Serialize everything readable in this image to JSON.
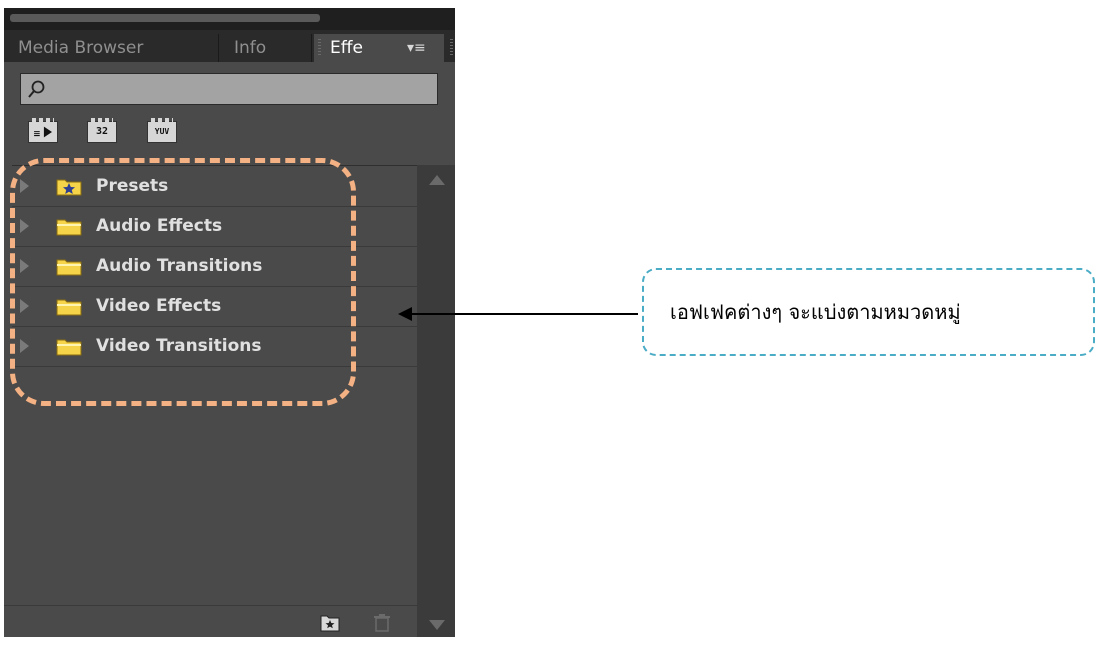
{
  "tabs": [
    {
      "label": "Media Browser"
    },
    {
      "label": "Info"
    },
    {
      "label": "Effe"
    }
  ],
  "tab_menu_icon": "panel-menu-icon",
  "search": {
    "placeholder": "",
    "icon": "search-icon"
  },
  "filters": [
    {
      "label": "",
      "icon": "accelerated-effects-icon"
    },
    {
      "label": "32",
      "icon": "32-bit-color-icon"
    },
    {
      "label": "YUV",
      "icon": "yuv-effects-icon"
    }
  ],
  "effects_tree": [
    {
      "label": "Presets",
      "icon": "presets-folder-icon"
    },
    {
      "label": "Audio Effects",
      "icon": "folder-icon"
    },
    {
      "label": "Audio Transitions",
      "icon": "folder-icon"
    },
    {
      "label": "Video Effects",
      "icon": "folder-icon"
    },
    {
      "label": "Video Transitions",
      "icon": "folder-icon"
    }
  ],
  "bottom_icons": [
    "new-custom-bin-icon",
    "delete-icon"
  ],
  "callout": {
    "text": "เอฟเฟคต่างๆ จะแบ่งตามหมวดหมู่"
  },
  "colors": {
    "panel_bg": "#4a4a4a",
    "highlight_border": "#f4b183",
    "callout_border": "#4bacc6",
    "folder": "#f5d44a"
  }
}
